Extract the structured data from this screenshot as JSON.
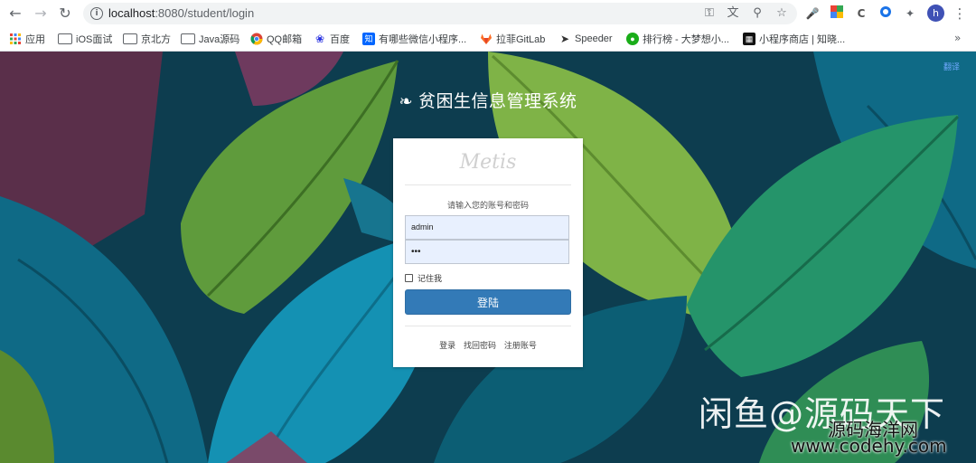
{
  "browser": {
    "url_host": "localhost",
    "url_path": ":8080/student/login",
    "profile_initial": "h",
    "bookmarks": [
      {
        "label": "应用",
        "icon": "apps-grid-icon"
      },
      {
        "label": "iOS面试",
        "icon": "folder-icon"
      },
      {
        "label": "京北方",
        "icon": "folder-icon"
      },
      {
        "label": "Java源码",
        "icon": "folder-icon"
      },
      {
        "label": "QQ邮箱",
        "icon": "chrome-icon"
      },
      {
        "label": "百度",
        "icon": "baidu-paw-icon"
      },
      {
        "label": "有哪些微信小程序...",
        "icon": "zhihu-icon"
      },
      {
        "label": "拉菲GitLab",
        "icon": "gitlab-icon"
      },
      {
        "label": "Speeder",
        "icon": "speeder-icon"
      },
      {
        "label": "排行榜 - 大梦想小...",
        "icon": "green-logo-icon"
      },
      {
        "label": "小程序商店 | 知晓...",
        "icon": "qr-icon"
      }
    ],
    "more": "»"
  },
  "page": {
    "system_title": "贫困生信息管理系统",
    "corner_link": "翻译"
  },
  "login": {
    "logo": "Metis",
    "prompt": "请输入您的账号和密码",
    "username": "admin",
    "password_mask": "•••",
    "remember_label": "记住我",
    "submit_label": "登陆",
    "links": [
      "登录",
      "找回密码",
      "注册账号"
    ]
  },
  "watermark": {
    "line1": "闲鱼@源码天下",
    "line2": "源码海洋网",
    "line3": "www.codehy.com"
  },
  "colors": {
    "button_blue": "#337ab7",
    "input_fill": "#e8f0fe"
  }
}
